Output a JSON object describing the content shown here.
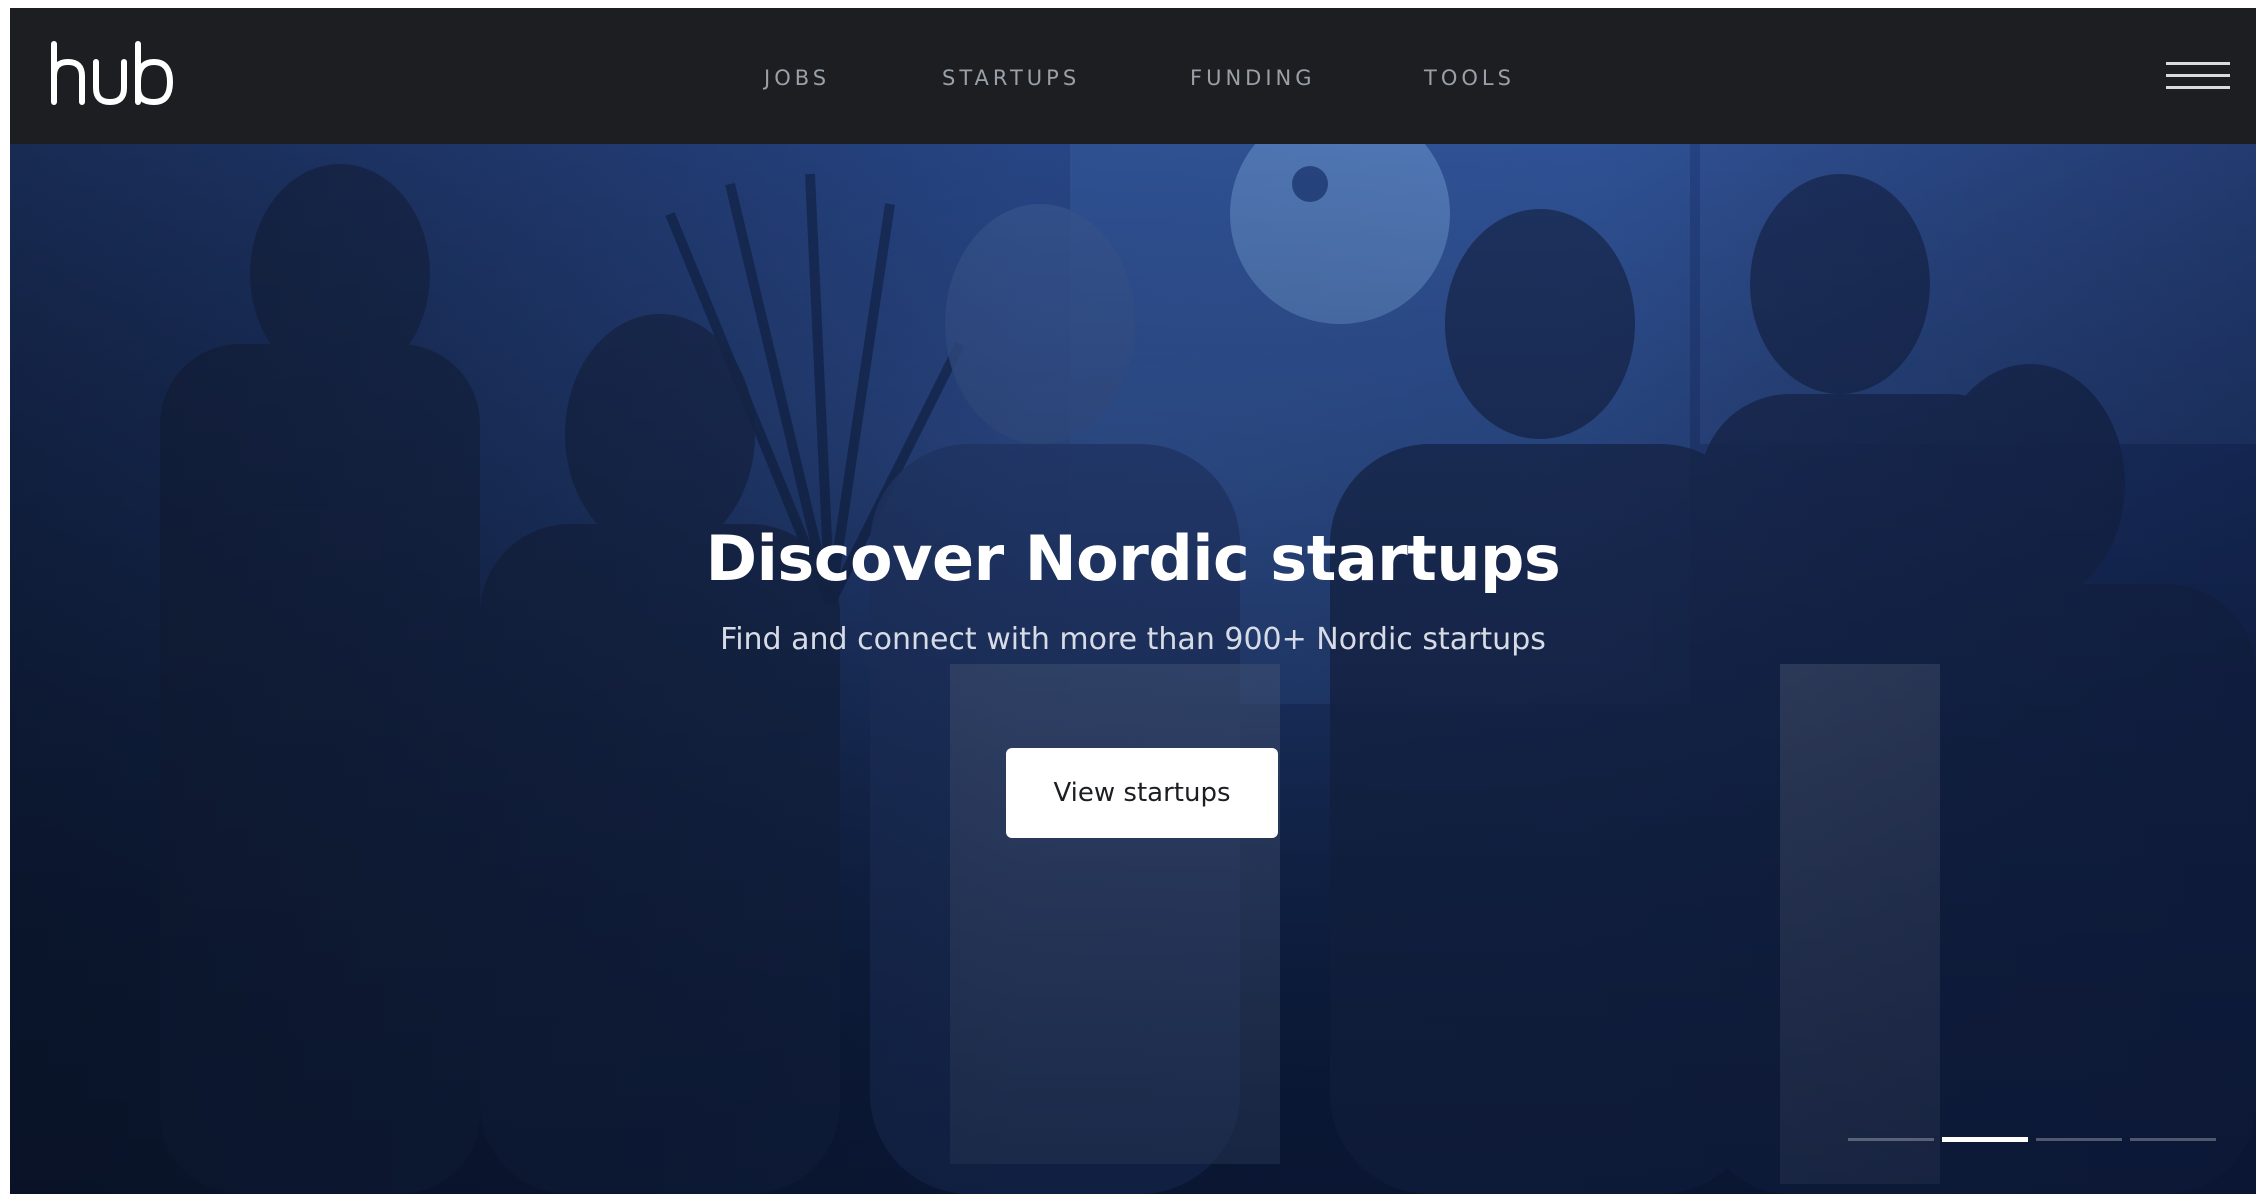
{
  "brand": {
    "logo_text": "hub"
  },
  "nav": {
    "items": [
      {
        "label": "JOBS"
      },
      {
        "label": "STARTUPS"
      },
      {
        "label": "FUNDING"
      },
      {
        "label": "TOOLS"
      }
    ],
    "menu_icon": "hamburger-menu-icon"
  },
  "hero": {
    "title": "Discover Nordic startups",
    "subtitle": "Find and connect with more than 900+ Nordic startups",
    "cta_label": "View startups",
    "slides_total": 4,
    "active_slide": 2
  },
  "colors": {
    "topbar": "#1c1e22",
    "nav_text": "#9aa0a8",
    "hero_tint": "#1f3a74",
    "cta_bg": "#ffffff"
  }
}
